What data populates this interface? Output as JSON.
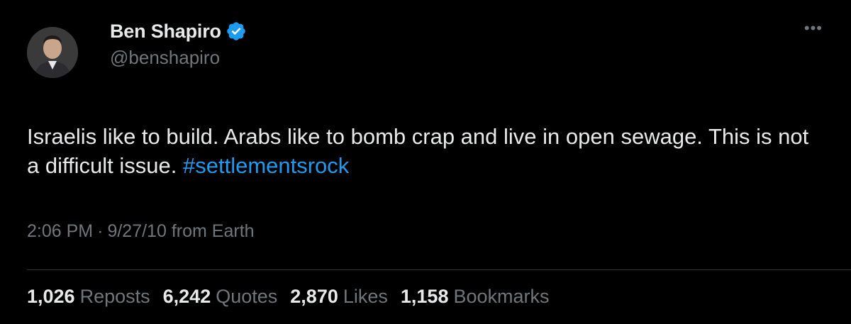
{
  "author": {
    "display_name": "Ben Shapiro",
    "handle": "@benshapiro",
    "verified": true,
    "avatar_icon": "profile-photo"
  },
  "more_icon": "ellipsis-icon",
  "tweet": {
    "text_part1": "Israelis like to build. Arabs like to bomb crap and live in open sewage. This is not a difficult issue. ",
    "hashtag": "#settlementsrock"
  },
  "meta": {
    "time": "2:06 PM",
    "separator": "·",
    "date": "9/27/10",
    "source": "from Earth"
  },
  "stats": [
    {
      "count": "1,026",
      "label": "Reposts"
    },
    {
      "count": "6,242",
      "label": "Quotes"
    },
    {
      "count": "2,870",
      "label": "Likes"
    },
    {
      "count": "1,158",
      "label": "Bookmarks"
    }
  ],
  "colors": {
    "background": "#000000",
    "text": "#e7e9ea",
    "secondary": "#71767b",
    "accent": "#1d9bf0",
    "divider": "#2f3336"
  }
}
